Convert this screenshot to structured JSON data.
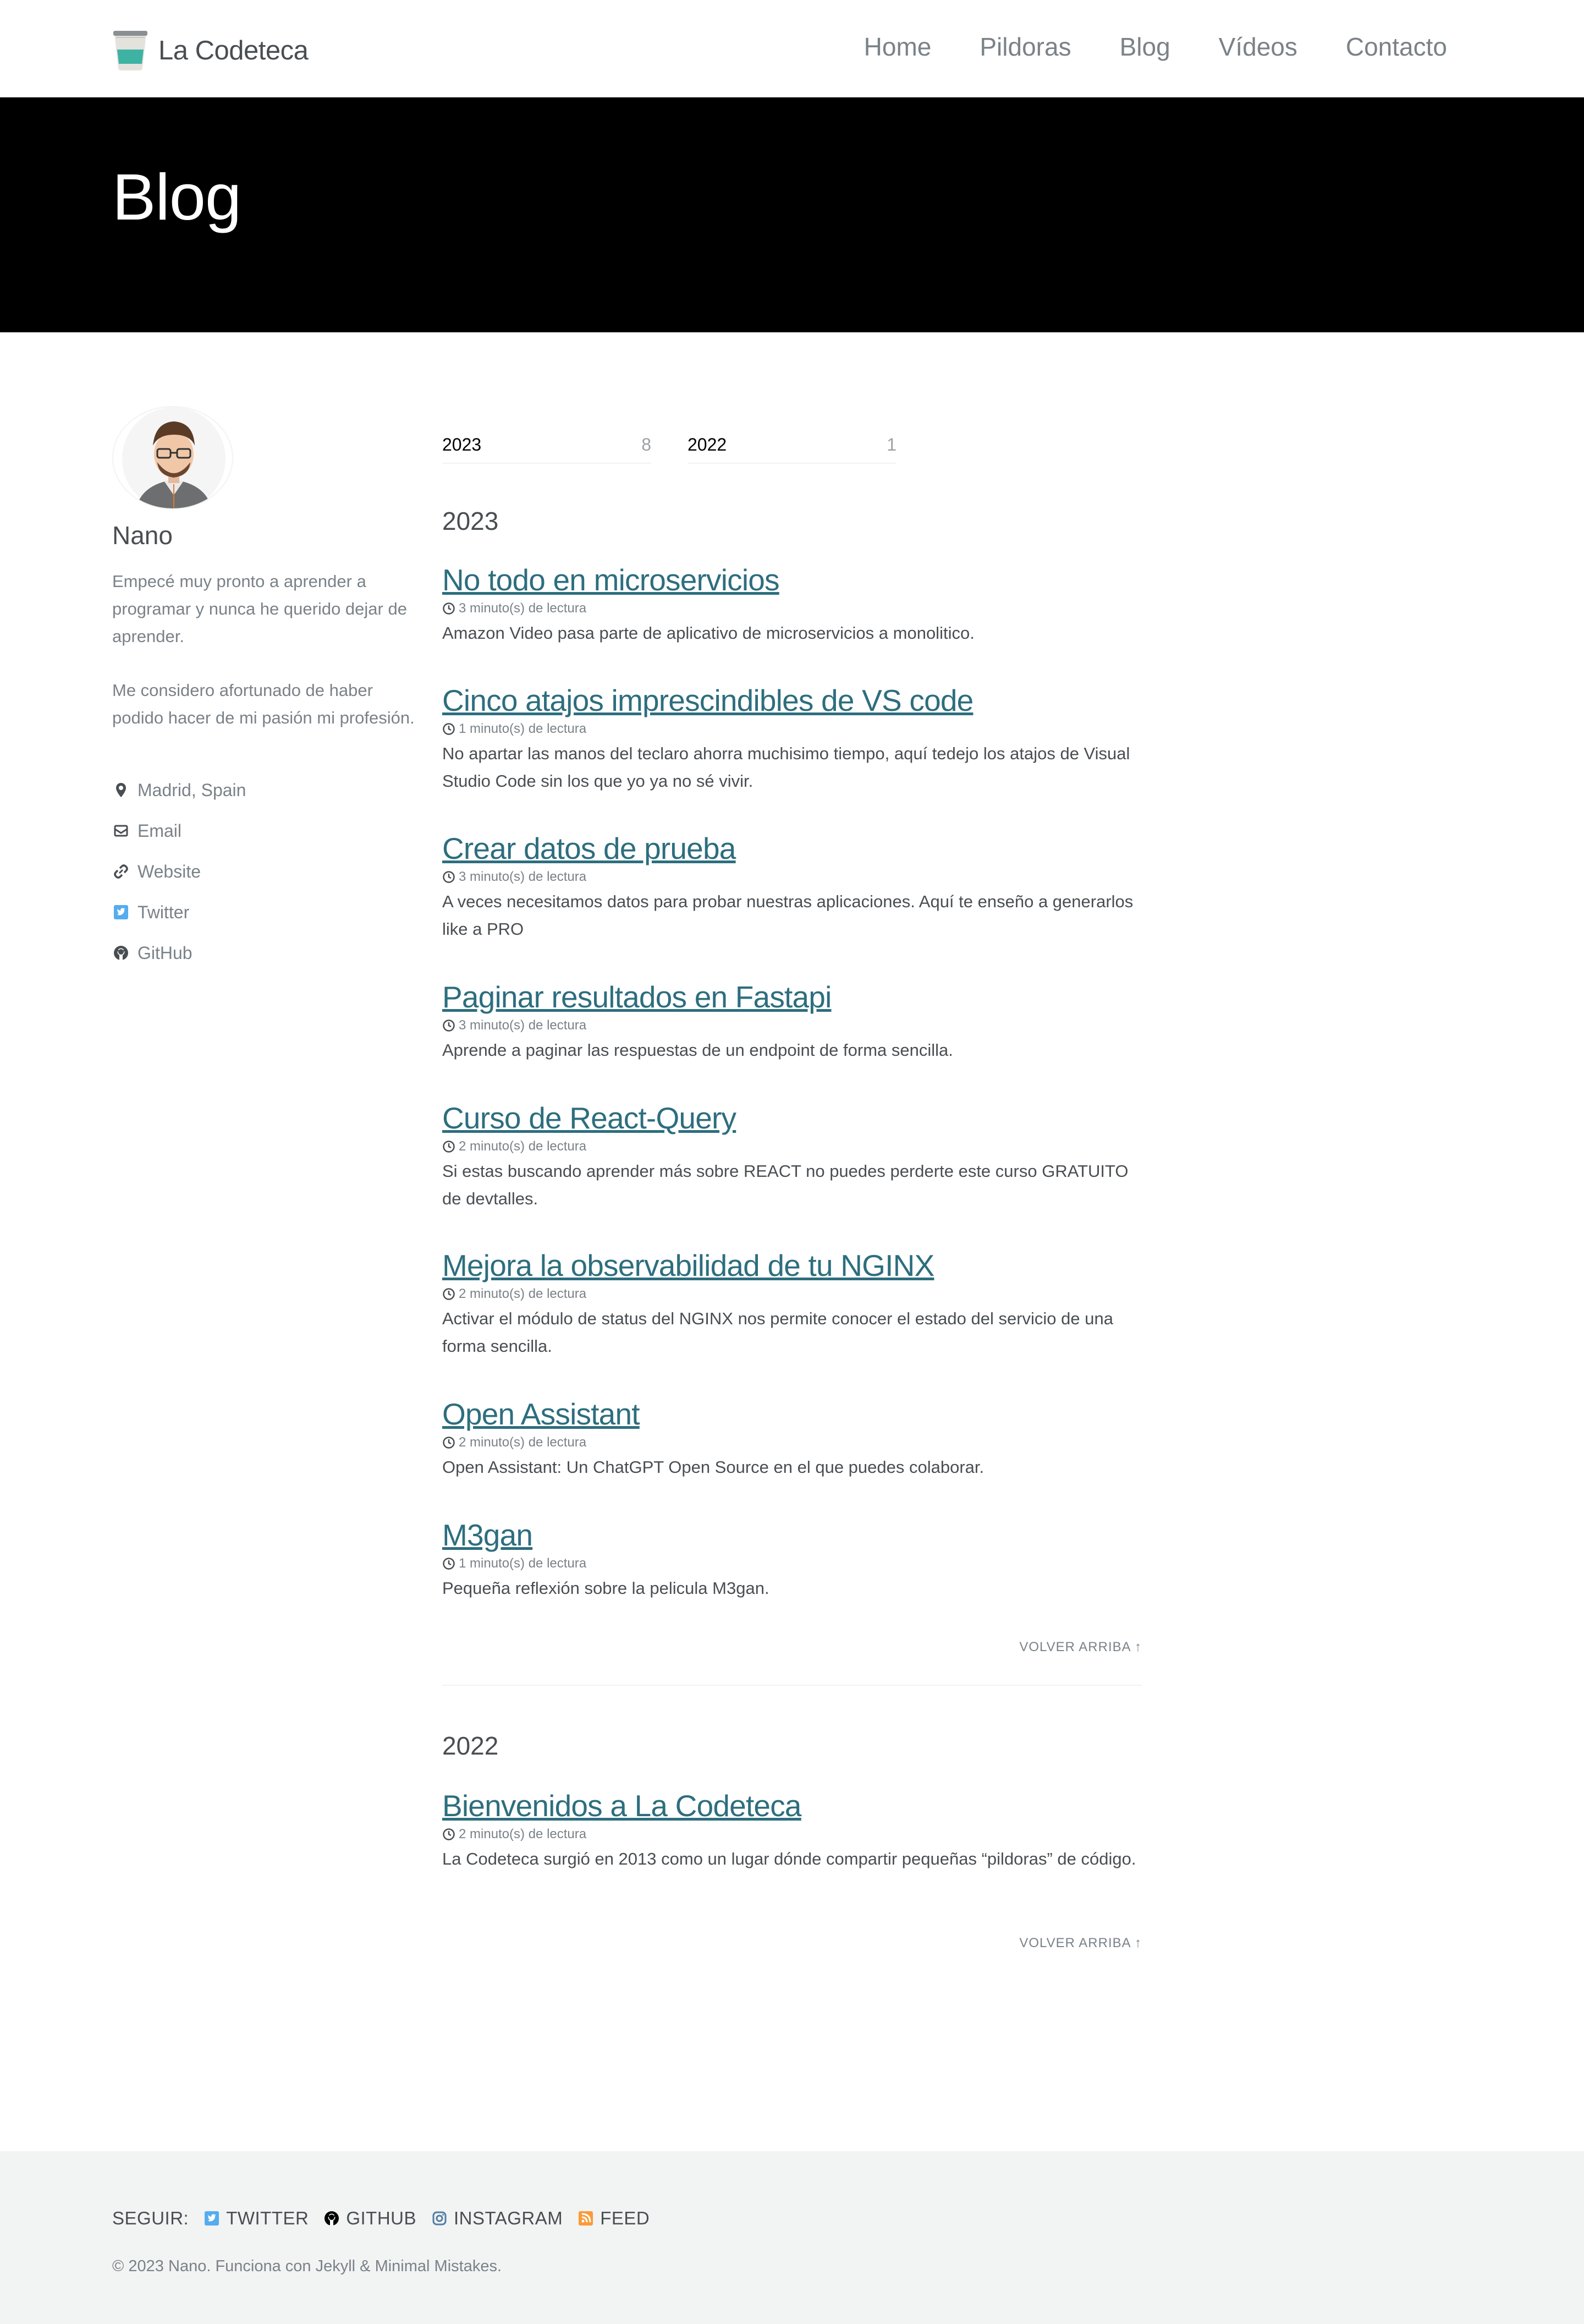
{
  "header": {
    "site_title": "La Codeteca",
    "nav": [
      {
        "label": "Home"
      },
      {
        "label": "Pildoras"
      },
      {
        "label": "Blog"
      },
      {
        "label": "Vídeos"
      },
      {
        "label": "Contacto"
      }
    ]
  },
  "hero": {
    "title": "Blog"
  },
  "author": {
    "name": "Nano",
    "bio": [
      "Empecé muy pronto a aprender a programar y nunca he querido dejar de aprender.",
      "Me considero afortunado de haber podido hacer de mi pasión mi profesión."
    ],
    "links": [
      {
        "label": "Madrid, Spain",
        "icon": "map-marker-icon"
      },
      {
        "label": "Email",
        "icon": "envelope-icon"
      },
      {
        "label": "Website",
        "icon": "link-icon"
      },
      {
        "label": "Twitter",
        "icon": "twitter-icon"
      },
      {
        "label": "GitHub",
        "icon": "github-icon"
      }
    ]
  },
  "taxonomy": [
    {
      "year": "2023",
      "count": "8"
    },
    {
      "year": "2022",
      "count": "1"
    }
  ],
  "sections": [
    {
      "year": "2023",
      "posts": [
        {
          "title": "No todo en microservicios",
          "meta": "3 minuto(s) de lectura",
          "excerpt": "Amazon Video pasa parte de aplicativo de microservicios a monolitico."
        },
        {
          "title": "Cinco atajos imprescindibles de VS code",
          "meta": "1 minuto(s) de lectura",
          "excerpt": "No apartar las manos del teclaro ahorra muchisimo tiempo, aquí tedejo los atajos de Visual Studio Code sin los que yo ya no sé vivir."
        },
        {
          "title": "Crear datos de prueba",
          "meta": "3 minuto(s) de lectura",
          "excerpt": "A veces necesitamos datos para probar nuestras aplicaciones. Aquí te enseño a generarlos like a PRO"
        },
        {
          "title": "Paginar resultados en Fastapi",
          "meta": "3 minuto(s) de lectura",
          "excerpt": "Aprende a paginar las respuestas de un endpoint de forma sencilla."
        },
        {
          "title": "Curso de React-Query",
          "meta": "2 minuto(s) de lectura",
          "excerpt": "Si estas buscando aprender más sobre REACT no puedes perderte este curso GRATUITO de devtalles."
        },
        {
          "title": "Mejora la observabilidad de tu NGINX",
          "meta": "2 minuto(s) de lectura",
          "excerpt": "Activar el módulo de status del NGINX nos permite conocer el estado del servicio de una forma sencilla."
        },
        {
          "title": "Open Assistant",
          "meta": "2 minuto(s) de lectura",
          "excerpt": "Open Assistant: Un ChatGPT Open Source en el que puedes colaborar."
        },
        {
          "title": "M3gan",
          "meta": "1 minuto(s) de lectura",
          "excerpt": "Pequeña reflexión sobre la pelicula M3gan."
        }
      ],
      "back_to_top": "VOLVER ARRIBA ↑"
    },
    {
      "year": "2022",
      "posts": [
        {
          "title": "Bienvenidos a La Codeteca",
          "meta": "2 minuto(s) de lectura",
          "excerpt": "La Codeteca surgió en 2013 como un lugar dónde compartir pequeñas “pildoras” de código."
        }
      ],
      "back_to_top": "VOLVER ARRIBA ↑"
    }
  ],
  "footer": {
    "follow_label": "SEGUIR:",
    "follow_links": [
      {
        "label": "TWITTER",
        "icon": "twitter-icon"
      },
      {
        "label": "GITHUB",
        "icon": "github-icon"
      },
      {
        "label": "INSTAGRAM",
        "icon": "instagram-icon"
      },
      {
        "label": "FEED",
        "icon": "rss-icon"
      }
    ],
    "copyright": "© 2023 Nano. Funciona con Jekyll & Minimal Mistakes."
  },
  "colors": {
    "link": "#2d6e7e",
    "hero_bg": "#000000",
    "footer_bg": "#f2f3f3",
    "twitter": "#55acee",
    "rss": "#fa9b39"
  }
}
